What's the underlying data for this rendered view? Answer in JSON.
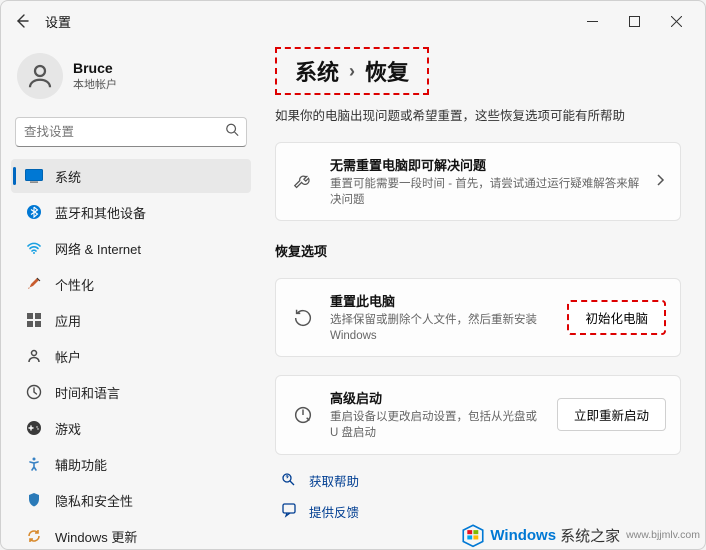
{
  "titlebar": {
    "title": "设置"
  },
  "user": {
    "name": "Bruce",
    "subtitle": "本地帐户"
  },
  "search": {
    "placeholder": "查找设置"
  },
  "nav": {
    "items": [
      {
        "label": "系统"
      },
      {
        "label": "蓝牙和其他设备"
      },
      {
        "label": "网络 & Internet"
      },
      {
        "label": "个性化"
      },
      {
        "label": "应用"
      },
      {
        "label": "帐户"
      },
      {
        "label": "时间和语言"
      },
      {
        "label": "游戏"
      },
      {
        "label": "辅助功能"
      },
      {
        "label": "隐私和安全性"
      },
      {
        "label": "Windows 更新"
      }
    ]
  },
  "breadcrumb": {
    "root": "系统",
    "current": "恢复"
  },
  "intro": "如果你的电脑出现问题或希望重置，这些恢复选项可能有所帮助",
  "troubleshoot": {
    "title": "无需重置电脑即可解决问题",
    "desc": "重置可能需要一段时间 - 首先，请尝试通过运行疑难解答来解决问题"
  },
  "recovery_section_title": "恢复选项",
  "reset": {
    "title": "重置此电脑",
    "desc": "选择保留或删除个人文件，然后重新安装 Windows",
    "button": "初始化电脑"
  },
  "advanced": {
    "title": "高级启动",
    "desc": "重启设备以更改启动设置，包括从光盘或 U 盘启动",
    "button": "立即重新启动"
  },
  "links": {
    "help": "获取帮助",
    "feedback": "提供反馈"
  },
  "watermark": {
    "brand": "Windows",
    "suffix": "系统之家",
    "url": "www.bjjmlv.com"
  }
}
